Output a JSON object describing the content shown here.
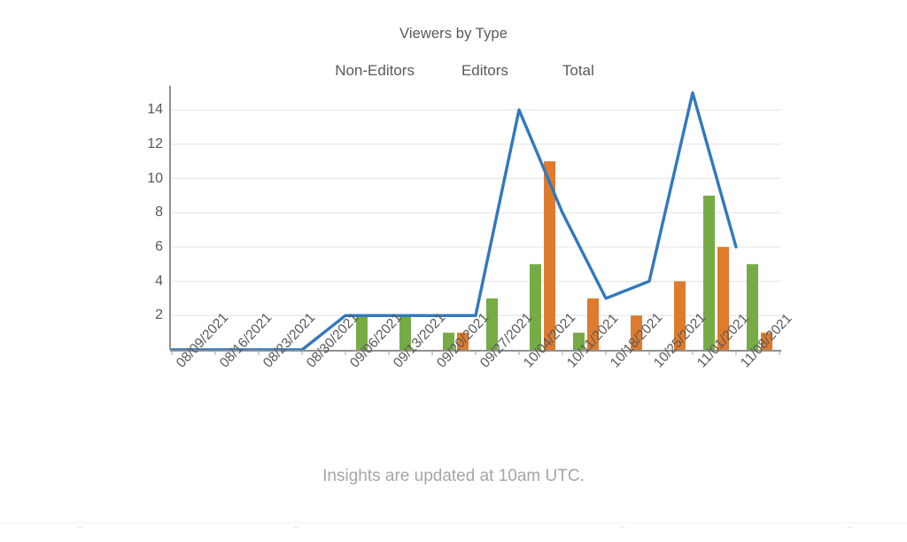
{
  "chart_data": {
    "type": "bar",
    "title": "Viewers by Type",
    "xlabel": "",
    "ylabel": "",
    "ylim": [
      0,
      15
    ],
    "ytick_values": [
      2,
      4,
      6,
      8,
      10,
      12,
      14
    ],
    "ytick_labels": [
      "2",
      "4",
      "6",
      "8",
      "10",
      "12",
      "14"
    ],
    "grid": true,
    "legend_position": "top-center",
    "categories": [
      "08/09/2021",
      "08/16/2021",
      "08/23/2021",
      "08/30/2021",
      "09/06/2021",
      "09/13/2021",
      "09/20/2021",
      "09/27/2021",
      "10/04/2021",
      "10/11/2021",
      "10/18/2021",
      "10/25/2021",
      "11/01/2021",
      "11/08/2021"
    ],
    "series": [
      {
        "name": "Non-Editors",
        "type": "bar",
        "color": "#76AB45",
        "values": [
          0,
          0,
          0,
          0,
          2,
          2,
          1,
          3,
          5,
          1,
          0,
          0,
          9,
          5
        ]
      },
      {
        "name": "Editors",
        "type": "bar",
        "color": "#DE7B2D",
        "values": [
          0,
          0,
          0,
          0,
          0,
          0,
          1,
          0,
          11,
          3,
          2,
          4,
          6,
          1
        ]
      },
      {
        "name": "Total",
        "type": "line",
        "color": "#3178BE",
        "values": [
          0,
          0,
          0,
          0,
          2,
          2,
          2,
          2,
          14,
          8,
          3,
          4,
          15,
          6
        ]
      }
    ]
  },
  "footer": {
    "note": "Insights are updated at 10am UTC."
  },
  "legend": {
    "items": [
      {
        "label": "Non-Editors",
        "marker": "square-swatch-green",
        "color": "#76AB45"
      },
      {
        "label": "Editors",
        "marker": "square-swatch-orange",
        "color": "#DE7B2D"
      },
      {
        "label": "Total",
        "marker": "line-swatch-blue",
        "color": "#3178BE"
      }
    ]
  }
}
